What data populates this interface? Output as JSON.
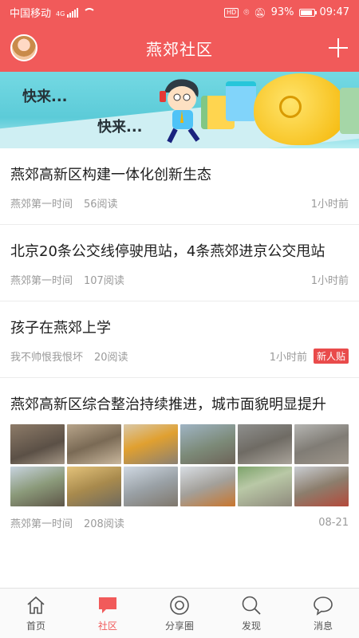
{
  "statusbar": {
    "carrier": "中国移动",
    "net": "4G",
    "battery": "93%",
    "time": "09:47",
    "hd": "HD"
  },
  "header": {
    "title": "燕郊社区"
  },
  "banner": {
    "text1": "快来...",
    "text2": "快来..."
  },
  "feed": [
    {
      "title": "燕郊高新区构建一体化创新生态",
      "source": "燕郊第一时间",
      "reads": "56阅读",
      "time": "1小时前"
    },
    {
      "title": "北京20条公交线停驶甩站，4条燕郊进京公交甩站",
      "source": "燕郊第一时间",
      "reads": "107阅读",
      "time": "1小时前"
    },
    {
      "title": "孩子在燕郊上学",
      "source": "我不帅恨我恨坏",
      "reads": "20阅读",
      "time": "1小时前",
      "badge": "新人贴"
    },
    {
      "title": "燕郊高新区综合整治持续推进，城市面貌明显提升",
      "source": "燕郊第一时间",
      "reads": "208阅读",
      "time": "08-21"
    }
  ],
  "tabs": [
    {
      "label": "首页",
      "icon": "home-icon"
    },
    {
      "label": "社区",
      "icon": "chat-bubble-icon",
      "active": true
    },
    {
      "label": "分享圈",
      "icon": "share-circle-icon"
    },
    {
      "label": "发现",
      "icon": "search-icon"
    },
    {
      "label": "消息",
      "icon": "message-icon"
    }
  ],
  "colors": {
    "accent": "#f15a5a"
  }
}
